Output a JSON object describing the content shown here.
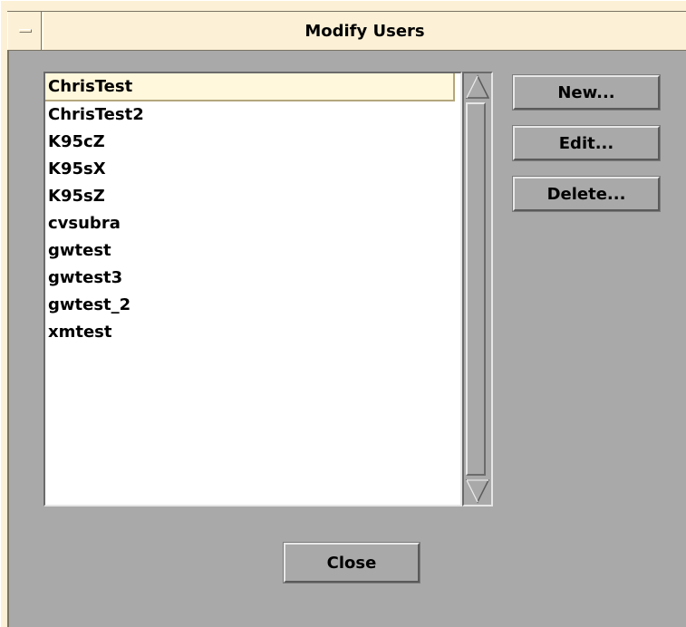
{
  "window": {
    "title": "Modify Users",
    "menu_icon": "window-menu-icon"
  },
  "users": {
    "selected_index": 0,
    "items": [
      "ChrisTest",
      "ChrisTest2",
      "K95cZ",
      "K95sX",
      "K95sZ",
      "cvsubra",
      "gwtest",
      "gwtest3",
      "gwtest_2",
      "xmtest"
    ]
  },
  "scrollbar": {
    "up_icon": "triangle-up-icon",
    "down_icon": "triangle-down-icon"
  },
  "actions": {
    "new_label": "New...",
    "edit_label": "Edit...",
    "delete_label": "Delete...",
    "close_label": "Close"
  },
  "colors": {
    "frame": "#fcf0d6",
    "background": "#a9a9a9",
    "selection": "#fff8dc"
  }
}
